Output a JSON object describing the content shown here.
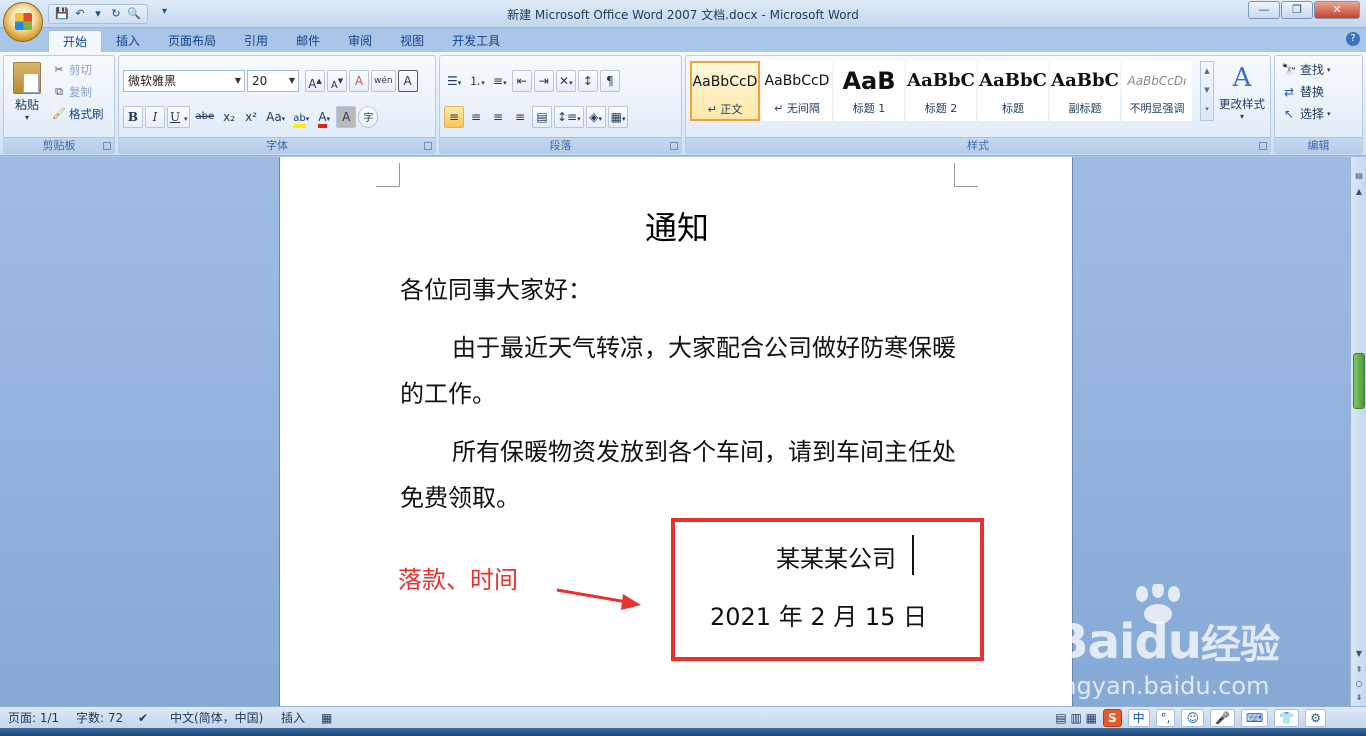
{
  "window": {
    "title": "新建 Microsoft Office Word 2007 文档.docx - Microsoft Word",
    "controls": [
      "minimize",
      "maximize",
      "close"
    ]
  },
  "quick_access": {
    "icons": [
      "save-icon",
      "undo-icon",
      "redo-icon",
      "print-preview-icon",
      "customize-icon"
    ]
  },
  "tabs": [
    "开始",
    "插入",
    "页面布局",
    "引用",
    "邮件",
    "审阅",
    "视图",
    "开发工具"
  ],
  "ribbon": {
    "clipboard": {
      "label": "剪贴板",
      "paste": "粘贴",
      "cut": "剪切",
      "copy": "复制",
      "format_painter": "格式刷"
    },
    "font": {
      "label": "字体",
      "font_name": "微软雅黑",
      "font_size": "20",
      "grow": "A",
      "shrink": "A",
      "clear": "A",
      "phonetic": "wén",
      "border": "A",
      "bold": "B",
      "italic": "I",
      "underline": "U",
      "strike": "abe",
      "subscript": "x₂",
      "superscript": "x²",
      "case": "Aa",
      "highlight": "ab",
      "font_color": "A",
      "shade": "A",
      "enclose": "字"
    },
    "paragraph": {
      "label": "段落"
    },
    "styles": {
      "label": "样式",
      "items": [
        {
          "preview": "AaBbCcD",
          "name": "正文",
          "active": true
        },
        {
          "preview": "AaBbCcD",
          "name": "无间隔",
          "active": false
        },
        {
          "preview": "AaB",
          "name": "标题 1",
          "active": false
        },
        {
          "preview": "AaBbC",
          "name": "标题 2",
          "active": false
        },
        {
          "preview": "AaBbC",
          "name": "标题",
          "active": false
        },
        {
          "preview": "AaBbC",
          "name": "副标题",
          "active": false
        },
        {
          "preview": "AaBbCcDı",
          "name": "不明显强调",
          "active": false
        }
      ],
      "change_styles": "更改样式"
    },
    "editing": {
      "label": "编辑",
      "find": "查找",
      "replace": "替换",
      "select": "选择"
    }
  },
  "document": {
    "title": "通知",
    "greeting": "各位同事大家好：",
    "paragraph1": "由于最近天气转凉，大家配合公司做好防寒保暖的工作。",
    "paragraph2": "所有保暖物资发放到各个车间，请到车间主任处免费领取。",
    "company": "某某某公司",
    "date": "2021 年 2 月 15 日"
  },
  "annotation": {
    "label": "落款、时间",
    "color": "#e8322f"
  },
  "statusbar": {
    "page": "页面: 1/1",
    "words": "字数: 72",
    "language": "中文(简体，中国)",
    "mode": "插入",
    "ime": [
      "S",
      "中",
      "°,",
      "☺",
      "🎤",
      "⌨",
      "👕",
      "⚙"
    ]
  },
  "watermark": {
    "brand": "Bai",
    "brand2": "du",
    "suffix": "经验",
    "url": "jingyan.baidu.com"
  }
}
